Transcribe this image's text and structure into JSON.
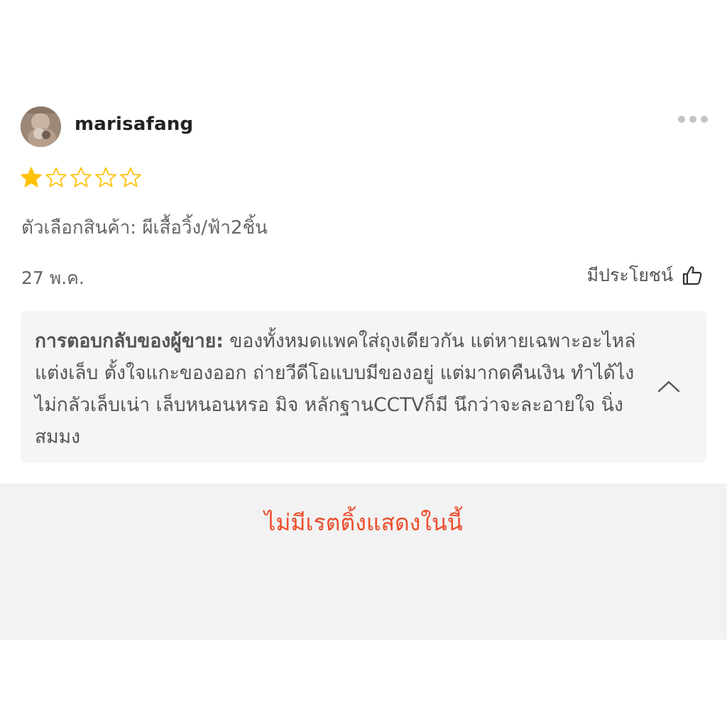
{
  "review": {
    "username": "marisafang",
    "rating": 1,
    "max_rating": 5,
    "variation": "ตัวเลือกสินค้า: ผีเสื้อวิ้ง/ฟ้า2ชิ้น",
    "date": "27 พ.ค.",
    "helpful_label": "มีประโยชน์",
    "star_color": "#ffc107"
  },
  "seller_reply": {
    "label": "การตอบกลับของผู้ขาย:",
    "text": " ของทั้งหมดแพคใส่ถุงเดียวกัน แต่หายเฉพาะอะไหล่แต่งเล็บ ตั้งใจแกะของออก ถ่ายวีดีโอแบบมีของอยู่ แต่มากดคืนเงิน ทำได้ไง ไม่กลัวเล็บเน่า เล็บหนอนหรอ มิจ หลักฐานCCTVก็มี นึกว่าจะละอายใจ นิ่งสมมง"
  },
  "empty_state": {
    "text": "ไม่มีเรตติ้งแสดงในนี้",
    "color": "#ee4d2d"
  }
}
